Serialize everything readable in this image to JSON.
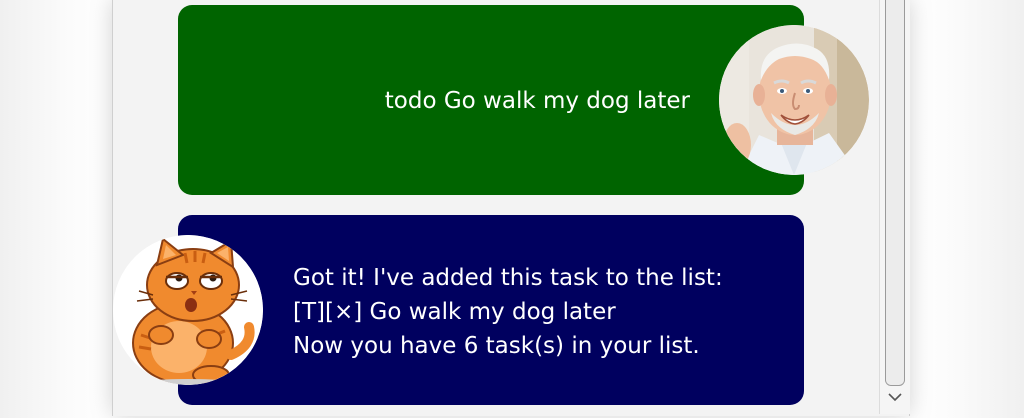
{
  "chat": {
    "user_message": {
      "text": "todo Go walk my dog later",
      "bubble_color": "#006400",
      "avatar": "elderly-man-avatar"
    },
    "bot_message": {
      "lines": [
        "Got it! I've added this task to the list:",
        "[T][×] Go walk my dog later",
        "Now you have 6 task(s) in your list."
      ],
      "bubble_color": "#00005f",
      "avatar": "orange-cat-avatar"
    }
  },
  "scrollbar": {
    "down_arrow_icon": "chevron-down-icon"
  }
}
